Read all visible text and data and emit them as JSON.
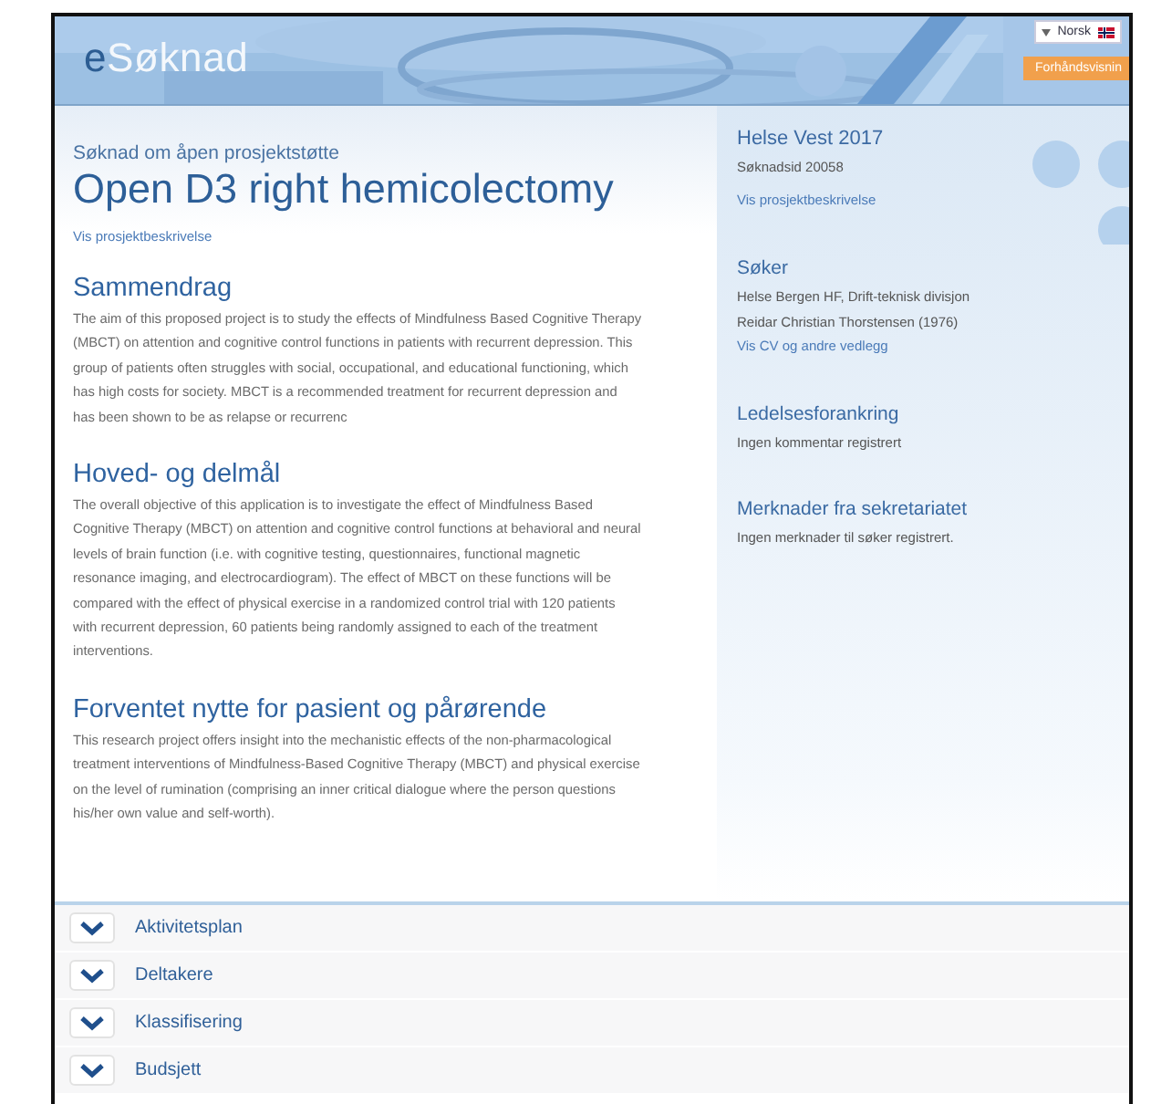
{
  "header": {
    "logo": "eSøknad",
    "language": "Norsk",
    "preview_button": "Forhåndsvisnin"
  },
  "application": {
    "type": "Søknad om åpen prosjektstøtte",
    "title": "Open D3 right hemicolectomy",
    "link": "Vis prosjektbeskrivelse",
    "sections": [
      {
        "heading": "Sammendrag",
        "text": "The aim of this proposed project is to study the effects of Mindfulness Based Cognitive Therapy (MBCT) on attention and cognitive control functions in patients with recurrent depression. This group of patients often struggles with social, occupational, and educational functioning, which has high costs for society. MBCT is a recommended treatment for recurrent depression and has been shown to be as relapse or recurrenc"
      },
      {
        "heading": "Hoved- og delmål",
        "text": "The overall objective of this application is to investigate the effect of Mindfulness Based Cognitive Therapy (MBCT) on attention and cognitive control functions at behavioral and neural levels of brain function (i.e. with cognitive testing, questionnaires, functional magnetic resonance imaging, and electrocardiogram). The effect of MBCT on these functions will be compared with the effect of physical exercise in a randomized control trial with 120 patients with recurrent depression, 60 patients being randomly assigned to each of the treatment interventions."
      },
      {
        "heading": "Forventet nytte for pasient og pårørende",
        "text": "This research project offers insight into the mechanistic effects of the non-pharmacological treatment interventions of Mindfulness-Based Cognitive Therapy (MBCT) and physical exercise on the level of rumination (comprising an inner critical dialogue where the person questions his/her own value and self-worth)."
      }
    ]
  },
  "sidebar": {
    "program": "Helse Vest 2017",
    "application_id": "Søknadsid 20058",
    "link": "Vis prosjektbeskrivelse",
    "blocks": [
      {
        "heading": "Søker",
        "lines": [
          {
            "kind": "text",
            "text": "Helse Bergen HF, Drift-teknisk divisjon"
          },
          {
            "kind": "text",
            "text": "Reidar Christian Thorstensen (1976)"
          },
          {
            "kind": "link",
            "text": "Vis CV og andre vedlegg"
          }
        ]
      },
      {
        "heading": "Ledelsesforankring",
        "lines": [
          {
            "kind": "text",
            "text": "Ingen kommentar registrert"
          }
        ]
      },
      {
        "heading": "Merknader fra sekretariatet",
        "lines": [
          {
            "kind": "text",
            "text": "Ingen merknader til søker registrert."
          }
        ]
      }
    ]
  },
  "accordion": [
    {
      "label": "Aktivitetsplan",
      "expanded": false
    },
    {
      "label": "Deltakere",
      "expanded": false
    },
    {
      "label": "Klassifisering",
      "expanded": false
    },
    {
      "label": "Budsjett",
      "expanded": false
    }
  ]
}
